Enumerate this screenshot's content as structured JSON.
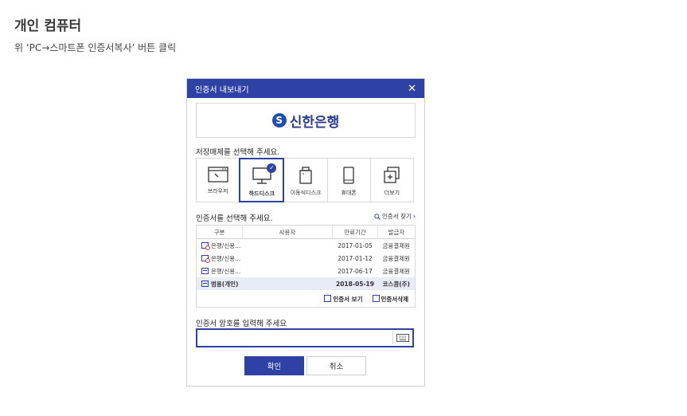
{
  "page": {
    "title": "개인 컴퓨터",
    "description": "위 ‘PC→스마트폰 인증서복사’ 버튼 클릭"
  },
  "dialog": {
    "title": "인증서 내보내기",
    "close_icon": "close-icon",
    "bank_name": "신한은행",
    "media_label": "저장매체를 선택해 주세요.",
    "media": [
      {
        "label": "브라우저",
        "icon": "browser-icon",
        "selected": false
      },
      {
        "label": "하드디스크",
        "icon": "hard-disk-icon",
        "selected": true
      },
      {
        "label": "이동식디스크",
        "icon": "removable-disk-icon",
        "selected": false
      },
      {
        "label": "휴대폰",
        "icon": "phone-icon",
        "selected": false
      },
      {
        "label": "더보기",
        "icon": "more-icon",
        "selected": false
      }
    ],
    "cert_label": "인증서를 선택해 주세요.",
    "find_cert": "인증서 찾기",
    "table": {
      "headers": [
        "구분",
        "사용자",
        "만료기간",
        "발급자"
      ],
      "rows": [
        {
          "type": "은행/신용...",
          "user": "",
          "expiry": "2017-01-05",
          "issuer": "금융결제원",
          "icon": "expired"
        },
        {
          "type": "은행/신용...",
          "user": "",
          "expiry": "2017-01-12",
          "issuer": "금융결제원",
          "icon": "expired"
        },
        {
          "type": "은행/신용...",
          "user": "",
          "expiry": "2017-06-17",
          "issuer": "금융결제원",
          "icon": "valid"
        },
        {
          "type": "범용(개인)",
          "user": "",
          "expiry": "2018-05-19",
          "issuer": "코스콤(주)",
          "icon": "valid",
          "selected": true
        }
      ]
    },
    "view_cert": "인증서 보기",
    "delete_cert": "인증서삭제",
    "password_label": "인증서 암호를 입력해 주세요",
    "password_value": "",
    "ok_label": "확인",
    "cancel_label": "취소",
    "colors": {
      "accent": "#2e42a5"
    }
  }
}
